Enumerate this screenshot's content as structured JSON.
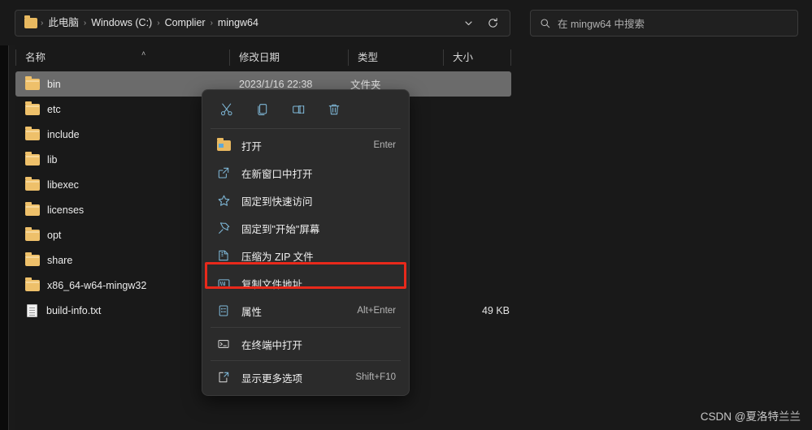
{
  "window": {
    "background_color": "#191919",
    "accent_icon_color": "#7fb8d8",
    "highlight_color": "#e8291b"
  },
  "addressbar": {
    "folder_icon": "folder-icon",
    "separator": "›",
    "crumbs": [
      "此电脑",
      "Windows (C:)",
      "Complier",
      "mingw64"
    ],
    "dropdown_icon": "chevron-down-icon",
    "refresh_icon": "refresh-icon"
  },
  "search": {
    "icon": "search-icon",
    "placeholder": "在 mingw64 中搜索",
    "value": ""
  },
  "columns": {
    "headers": [
      "名称",
      "修改日期",
      "类型",
      "大小"
    ],
    "sort_indicator": "˄"
  },
  "files": [
    {
      "name": "bin",
      "icon": "folder-icon",
      "date": "2023/1/16 22:38",
      "type": "文件夹",
      "size": "",
      "selected": true
    },
    {
      "name": "etc",
      "icon": "folder-icon",
      "date": "",
      "type": "",
      "size": "",
      "selected": false
    },
    {
      "name": "include",
      "icon": "folder-icon",
      "date": "",
      "type": "",
      "size": "",
      "selected": false
    },
    {
      "name": "lib",
      "icon": "folder-icon",
      "date": "",
      "type": "",
      "size": "",
      "selected": false
    },
    {
      "name": "libexec",
      "icon": "folder-icon",
      "date": "",
      "type": "",
      "size": "",
      "selected": false
    },
    {
      "name": "licenses",
      "icon": "folder-icon",
      "date": "",
      "type": "",
      "size": "",
      "selected": false
    },
    {
      "name": "opt",
      "icon": "folder-icon",
      "date": "",
      "type": "",
      "size": "",
      "selected": false
    },
    {
      "name": "share",
      "icon": "folder-icon",
      "date": "",
      "type": "",
      "size": "",
      "selected": false
    },
    {
      "name": "x86_64-w64-mingw32",
      "icon": "folder-icon",
      "date": "",
      "type": "",
      "size": "",
      "selected": false
    },
    {
      "name": "build-info.txt",
      "icon": "text-file-icon",
      "date": "",
      "type": "",
      "size": "49 KB",
      "selected": false
    }
  ],
  "context_menu": {
    "toolbar": [
      {
        "name": "cut",
        "icon": "scissors-icon"
      },
      {
        "name": "copy",
        "icon": "copy-icon"
      },
      {
        "name": "rename",
        "icon": "rename-icon"
      },
      {
        "name": "delete",
        "icon": "trash-icon"
      }
    ],
    "items": [
      {
        "label": "打开",
        "accel": "Enter",
        "icon": "folder-open-icon",
        "highlighted": false
      },
      {
        "label": "在新窗口中打开",
        "accel": "",
        "icon": "new-window-icon",
        "highlighted": false
      },
      {
        "label": "固定到快速访问",
        "accel": "",
        "icon": "star-icon",
        "highlighted": false
      },
      {
        "label": "固定到\"开始\"屏幕",
        "accel": "",
        "icon": "pin-icon",
        "highlighted": false
      },
      {
        "label": "压缩为 ZIP 文件",
        "accel": "",
        "icon": "zip-icon",
        "highlighted": false
      },
      {
        "label": "复制文件地址",
        "accel": "",
        "icon": "copy-path-icon",
        "highlighted": true
      },
      {
        "label": "属性",
        "accel": "Alt+Enter",
        "icon": "properties-icon",
        "highlighted": false
      },
      {
        "label": "在终端中打开",
        "accel": "",
        "icon": "terminal-icon",
        "highlighted": false
      },
      {
        "label": "显示更多选项",
        "accel": "Shift+F10",
        "icon": "more-options-icon",
        "highlighted": false
      }
    ]
  },
  "watermark": {
    "text": "CSDN @夏洛特兰兰"
  }
}
